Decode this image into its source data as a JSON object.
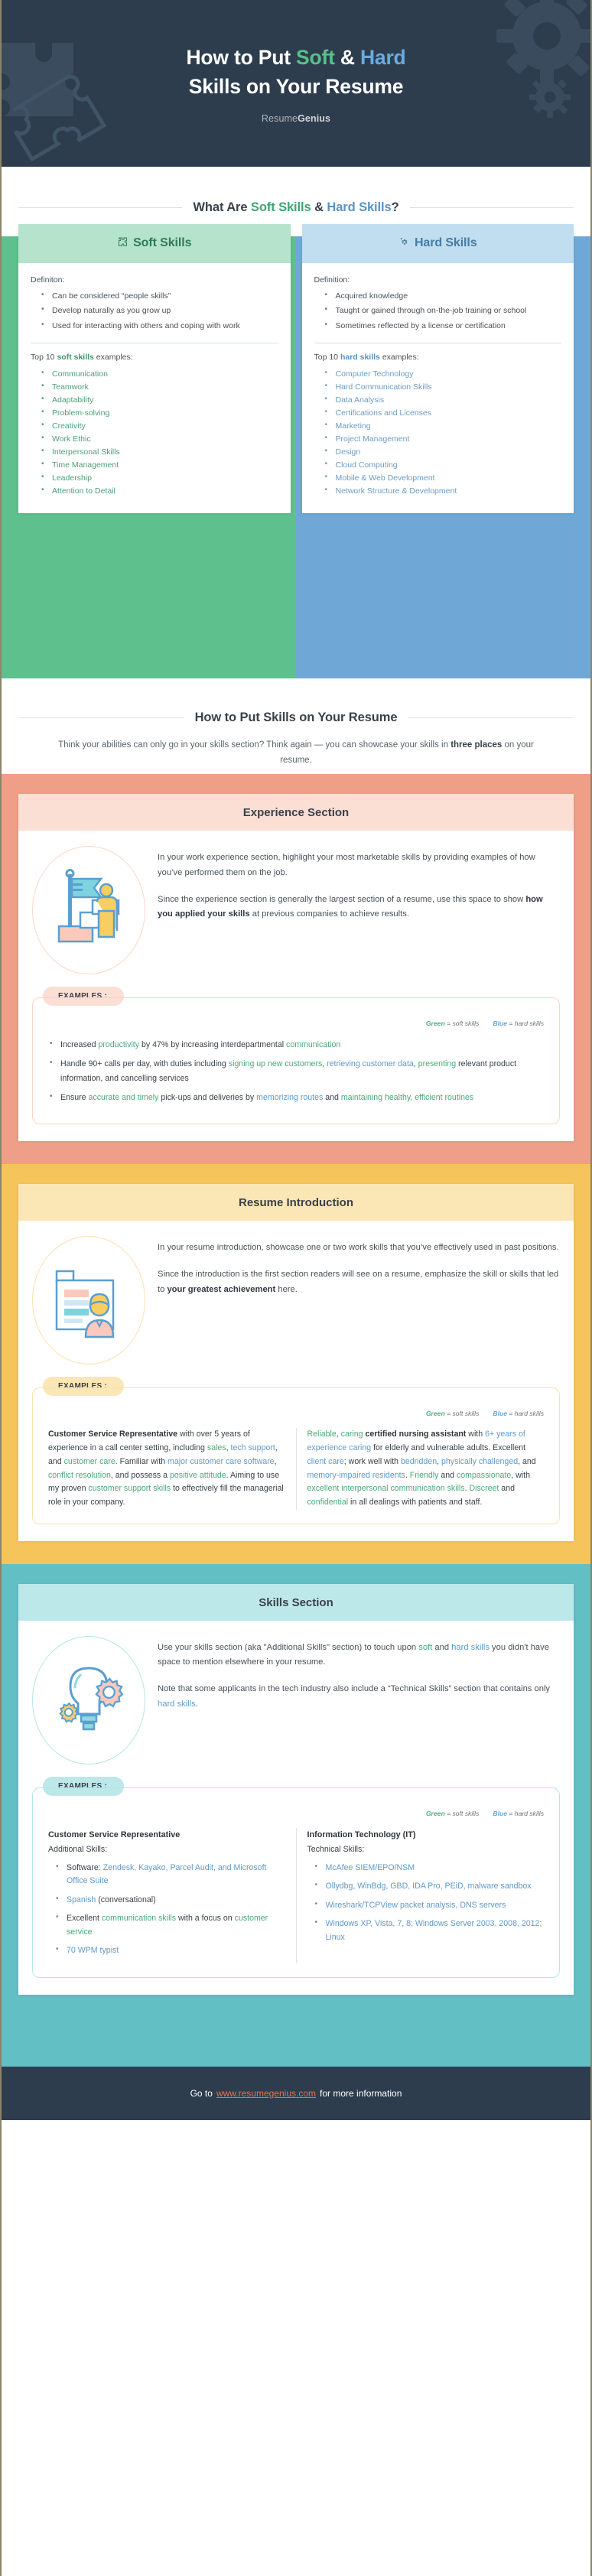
{
  "header": {
    "title_part1": "How to Put ",
    "title_soft": "Soft",
    "title_amp": " & ",
    "title_hard": "Hard",
    "title_line2": "Skills on Your Resume",
    "brand_light": "Resume",
    "brand_bold": "Genius"
  },
  "compare": {
    "heading_a": "What Are ",
    "heading_soft": "Soft Skills",
    "heading_amp": " & ",
    "heading_hard": "Hard Skills",
    "heading_q": "?",
    "soft_card": {
      "title": "Soft Skills",
      "icon": "puzzle-piece-icon",
      "definition_label": "Definiton:",
      "definition": [
        "Can be considered “people skills”",
        "Develop naturally as you grow up",
        "Used for interacting with others and coping with work"
      ],
      "top10_pre": "Top 10 ",
      "top10_bold": "soft skills",
      "top10_post": " examples:",
      "examples": [
        "Communication",
        "Teamwork",
        "Adaptability",
        "Problem-solving",
        "Creativity",
        "Work Ethic",
        "Interpersonal Skills",
        "Time Management",
        "Leadership",
        "Attention to Detail"
      ]
    },
    "hard_card": {
      "title": "Hard Skills",
      "icon": "gear-icon",
      "definition_label": "Definition:",
      "definition": [
        "Acquired knowledge",
        "Taught or gained through on-the-job training or school",
        "Sometimes reflected by a license or certification"
      ],
      "top10_pre": "Top 10 ",
      "top10_bold": "hard skills",
      "top10_post": " examples:",
      "examples": [
        "Computer Technology",
        "Hard Communication Skills",
        "Data Analysis",
        "Certifications and Licenses",
        "Marketing",
        "Project Management",
        "Design",
        "Cloud Computing",
        "Mobile & Web Development",
        "Network Structure & Development"
      ]
    }
  },
  "howto": {
    "heading": "How to Put Skills on Your Resume",
    "lead_a": "Think your abilities can only go in your skills section? Think again — you can showcase your skills in ",
    "lead_bold": "three places",
    "lead_b": " on your resume."
  },
  "legend": {
    "green": "Green",
    "green_text": " = soft skills",
    "blue": "Blue",
    "blue_text": " = hard skills"
  },
  "examples_tag": "EXAMPLES :",
  "experience": {
    "title": "Experience Section",
    "art": "person-with-flag-icon",
    "p1": "In your work experience section, highlight your most marketable skills by providing examples of how you’ve performed them on the job.",
    "p2_a": "Since the experience section is generally the largest section of a resume, use this space to show ",
    "p2_bold": "how you applied your skills",
    "p2_b": " at previous companies to achieve results.",
    "bullets": [
      [
        {
          "t": "Increased ",
          "c": "n"
        },
        {
          "t": "productivity",
          "c": "s"
        },
        {
          "t": " by 47% by increasing interdepartmental ",
          "c": "n"
        },
        {
          "t": "communication",
          "c": "s"
        }
      ],
      [
        {
          "t": "Handle 90+ calls per day, with duties including ",
          "c": "n"
        },
        {
          "t": "signing up new customers",
          "c": "s"
        },
        {
          "t": ", ",
          "c": "n"
        },
        {
          "t": "retrieving customer data",
          "c": "h"
        },
        {
          "t": ", ",
          "c": "n"
        },
        {
          "t": "presenting",
          "c": "s"
        },
        {
          "t": " relevant product information, and cancelling services",
          "c": "n"
        }
      ],
      [
        {
          "t": "Ensure ",
          "c": "n"
        },
        {
          "t": "accurate and timely",
          "c": "s"
        },
        {
          "t": " pick-ups and deliveries by ",
          "c": "n"
        },
        {
          "t": "memorizing routes",
          "c": "h"
        },
        {
          "t": " and ",
          "c": "n"
        },
        {
          "t": "maintaining healthy, efficient routines",
          "c": "s"
        }
      ]
    ]
  },
  "introduction": {
    "title": "Resume Introduction",
    "art": "id-card-person-icon",
    "p1": "In your resume introduction, showcase one or two work skills that you’ve effectively used in past positions.",
    "p2_a": "Since the introduction is the first section readers will see on a resume, emphasize the skill or skills that led to ",
    "p2_bold": "your greatest achievement",
    "p2_b": " here.",
    "left_example": {
      "heading": "Customer Service Representative",
      "parts": [
        {
          "t": " with over 5 years of experience in a call center setting, including ",
          "c": "n"
        },
        {
          "t": "sales",
          "c": "s"
        },
        {
          "t": ", ",
          "c": "n"
        },
        {
          "t": "tech support",
          "c": "h"
        },
        {
          "t": ", and ",
          "c": "n"
        },
        {
          "t": "customer care",
          "c": "s"
        },
        {
          "t": ". Familiar with ",
          "c": "n"
        },
        {
          "t": "major customer care software",
          "c": "h"
        },
        {
          "t": ", ",
          "c": "n"
        },
        {
          "t": "conflict resolution",
          "c": "s"
        },
        {
          "t": ", and possess a ",
          "c": "n"
        },
        {
          "t": "positive attitude",
          "c": "s"
        },
        {
          "t": ". Aiming to use my proven ",
          "c": "n"
        },
        {
          "t": "customer support skills",
          "c": "s"
        },
        {
          "t": " to effectively fill the managerial role in your company.",
          "c": "n"
        }
      ]
    },
    "right_example": {
      "parts": [
        {
          "t": "Reliable",
          "c": "s"
        },
        {
          "t": ", ",
          "c": "n"
        },
        {
          "t": "caring ",
          "c": "s"
        },
        {
          "t": "certified nursing assistant",
          "c": "b"
        },
        {
          "t": " with ",
          "c": "n"
        },
        {
          "t": "6+ years of experience caring",
          "c": "h"
        },
        {
          "t": " for elderly and vulnerable adults. Excellent ",
          "c": "n"
        },
        {
          "t": "client care",
          "c": "h"
        },
        {
          "t": "; work well with ",
          "c": "n"
        },
        {
          "t": "bedridden",
          "c": "h"
        },
        {
          "t": ", ",
          "c": "n"
        },
        {
          "t": "physically challenged",
          "c": "h"
        },
        {
          "t": ", and ",
          "c": "n"
        },
        {
          "t": "memory-impaired residents",
          "c": "h"
        },
        {
          "t": ". ",
          "c": "n"
        },
        {
          "t": "Friendly",
          "c": "s"
        },
        {
          "t": " and ",
          "c": "n"
        },
        {
          "t": "compassionate",
          "c": "s"
        },
        {
          "t": ", with ",
          "c": "n"
        },
        {
          "t": "excellent interpersonal communication skills",
          "c": "s"
        },
        {
          "t": ". ",
          "c": "n"
        },
        {
          "t": "Discreet",
          "c": "s"
        },
        {
          "t": " and ",
          "c": "n"
        },
        {
          "t": "confidential",
          "c": "s"
        },
        {
          "t": " in all dealings with patients and staff.",
          "c": "n"
        }
      ]
    }
  },
  "skills": {
    "title": "Skills Section",
    "art": "lightbulb-gears-icon",
    "p1_a": "Use your skills section (aka \"Additional Skills\" section) to touch upon ",
    "p1_soft": "soft",
    "p1_mid": " and ",
    "p1_hard": "hard skills",
    "p1_b": " you didn't have space to mention elsewhere in your resume.",
    "p2_a": "Note that some applicants in the tech industry also include a “Technical Skills” section that contains only ",
    "p2_hard": "hard skills",
    "p2_b": ".",
    "left_example": {
      "heading": "Customer Service Representative",
      "sub": "Additional Skills:",
      "bullets": [
        [
          {
            "t": "Software: ",
            "c": "n"
          },
          {
            "t": "Zendesk, Kayako, Parcel Audit, and Microsoft Office Suite",
            "c": "h"
          }
        ],
        [
          {
            "t": "Spanish",
            "c": "h"
          },
          {
            "t": " (conversational)",
            "c": "n"
          }
        ],
        [
          {
            "t": "Excellent ",
            "c": "n"
          },
          {
            "t": "communication skills",
            "c": "s"
          },
          {
            "t": " with a focus on ",
            "c": "n"
          },
          {
            "t": "customer service",
            "c": "s"
          }
        ],
        [
          {
            "t": "70 WPM typist",
            "c": "h"
          }
        ]
      ]
    },
    "right_example": {
      "heading": "Information Technology (IT)",
      "sub": "Technical Skills:",
      "bullets": [
        [
          {
            "t": "McAfee SIEM/EPO/NSM",
            "c": "h"
          }
        ],
        [
          {
            "t": "Ollydbg, WinBdg, GBD, IDA Pro, PEiD, malware sandbox",
            "c": "h"
          }
        ],
        [
          {
            "t": "Wireshark/TCPView packet analysis, DNS servers",
            "c": "h"
          }
        ],
        [
          {
            "t": "Windows XP, Vista, 7, 8; Windows Server 2003, 2008, 2012; Linux",
            "c": "h"
          }
        ]
      ]
    }
  },
  "footer": {
    "pre": "Go to ",
    "url": "www.resumegenius.com",
    "post": " for more information"
  },
  "colors": {
    "dark": "#2e3d4d",
    "green": "#5ec08d",
    "blue": "#6fa8d6",
    "peach": "#ef9e88",
    "yellow": "#f5c55c",
    "teal": "#62bfc4",
    "link": "#e8714f"
  }
}
